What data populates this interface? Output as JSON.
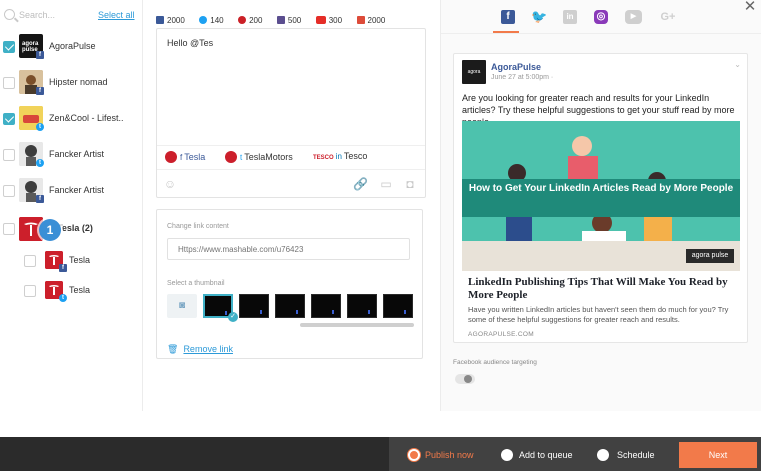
{
  "sidebar": {
    "search_placeholder": "Search...",
    "select_all": "Select all",
    "profiles": [
      {
        "name": "AgoraPulse",
        "checked": true,
        "network": "facebook"
      },
      {
        "name": "Hipster nomad",
        "checked": false,
        "network": "facebook"
      },
      {
        "name": "Zen&Cool - Lifest..",
        "checked": true,
        "network": "twitter"
      },
      {
        "name": "Fancker Artist",
        "checked": false,
        "network": "twitter"
      },
      {
        "name": "Fancker Artist",
        "checked": false,
        "network": "facebook"
      },
      {
        "name": "Tesla (2)",
        "checked": false,
        "network": "group"
      }
    ],
    "sub_profiles": [
      {
        "name": "Tesla",
        "checked": false,
        "network": "facebook"
      },
      {
        "name": "Tesla",
        "checked": false,
        "network": "twitter"
      }
    ],
    "step_badge": "1"
  },
  "composer": {
    "counts": [
      {
        "network": "facebook",
        "value": "2000",
        "color": "#3b5998"
      },
      {
        "network": "twitter",
        "value": "140",
        "color": "#1da1f2"
      },
      {
        "network": "pinterest",
        "value": "200",
        "color": "#cb2027"
      },
      {
        "network": "instagram",
        "value": "500",
        "color": "#5b4e8f"
      },
      {
        "network": "youtube",
        "value": "300",
        "color": "#e52d27"
      },
      {
        "network": "google-plus",
        "value": "2000",
        "color": "#dd4b39"
      }
    ],
    "message": "Hello @Tes",
    "mentions": [
      {
        "label": "Tesla",
        "network": "facebook"
      },
      {
        "label": "TeslaMotors",
        "network": "twitter"
      },
      {
        "label": "Tesco",
        "network": "linkedin"
      }
    ],
    "link": {
      "change_label": "Change link content",
      "url_placeholder": "Https://www.mashable.com/u76423",
      "thumbnail_label": "Select a thumbnail",
      "remove_label": "Remove link"
    }
  },
  "preview": {
    "page_name": "AgoraPulse",
    "avatar_text": "agora pulse",
    "post_time": "June 27 at 5:00pm ·",
    "post_text": "Are you looking for greater reach and results for your LinkedIn articles? Try these helpful suggestions to get your stuff read by more people.",
    "image_headline": "How to Get Your LinkedIn Articles Read by More People",
    "image_brand": "agora pulse",
    "link_title": "LinkedIn Publishing Tips That Will Make You Read by More People",
    "link_description": "Have you written LinkedIn articles but haven't seen them do much for you? Try some of these helpful suggestions for greater reach and results.",
    "link_domain": "AGORAPULSE.COM",
    "audience_label": "Facebook audience targeting",
    "tab_colors": {
      "facebook": "#3b5998",
      "twitter": "#1da1f2",
      "linkedin": "#cfcfcf",
      "instagram": "#8a3ab9",
      "youtube": "#cfcfcf",
      "googleplus": "#cfcfcf"
    },
    "active_tab": "facebook"
  },
  "footer": {
    "publish_now": "Publish now",
    "add_to_queue": "Add to queue",
    "schedule": "Schedule",
    "selected": "publish_now",
    "next": "Next",
    "accent": "#f27a4a"
  }
}
